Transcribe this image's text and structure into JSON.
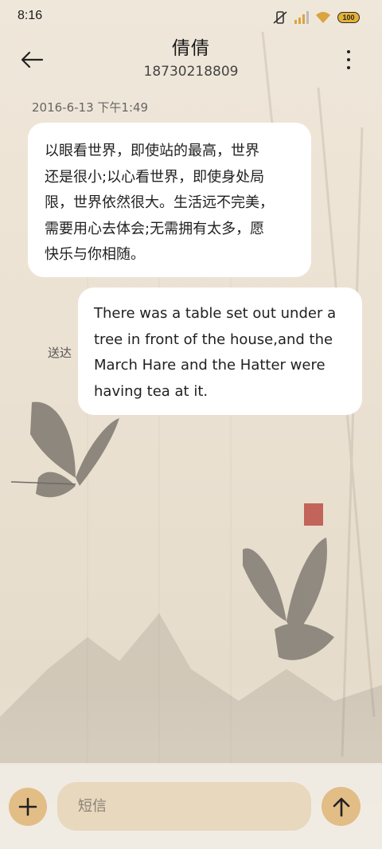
{
  "status_bar": {
    "time": "8:16",
    "battery_level": "100",
    "icons": [
      "vibrate-off-icon",
      "signal-icon",
      "wifi-icon",
      "battery-icon"
    ]
  },
  "header": {
    "contact_name": "倩倩",
    "contact_number": "18730218809",
    "back_icon": "arrow-left-icon",
    "more_icon": "more-vertical-icon"
  },
  "conversation": {
    "timestamp": "2016-6-13 下午1:49",
    "messages": [
      {
        "direction": "incoming",
        "lines": [
          "以眼看世界，即使站的最高，世界",
          "还是很小;以心看世界，即使身处局",
          "限，世界依然很大。生活远不完美，",
          "需要用心去体会;无需拥有太多，愿",
          "快乐与你相随。"
        ]
      },
      {
        "direction": "outgoing",
        "status": "送达",
        "lines": [
          "There was a table set out under a",
          "tree in front of the house,and the",
          "March Hare and the Hatter were",
          "having tea at it."
        ]
      }
    ]
  },
  "composer": {
    "add_icon": "plus-icon",
    "placeholder": "短信",
    "value": "",
    "send_icon": "arrow-up-icon"
  },
  "colors": {
    "background": "#ebe1d2",
    "bubble": "#ffffff",
    "accent_button": "#e2bd86",
    "input_field": "#e7d8be"
  }
}
